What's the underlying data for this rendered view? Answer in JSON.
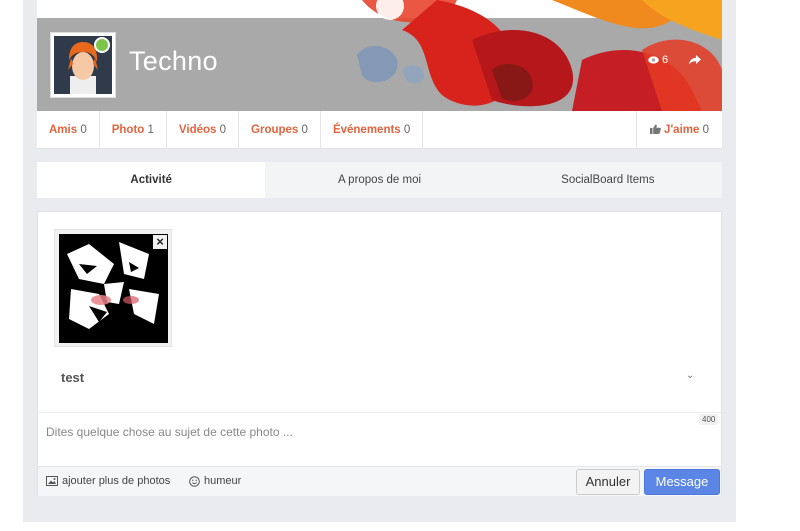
{
  "profile": {
    "name": "Techno",
    "views_count": "6",
    "avatar_icon": "user-avatar-orange-hair"
  },
  "stats": [
    {
      "label": "Amis",
      "count": "0"
    },
    {
      "label": "Photo",
      "count": "1"
    },
    {
      "label": "Vidéos",
      "count": "0"
    },
    {
      "label": "Groupes",
      "count": "0"
    },
    {
      "label": "Événements",
      "count": "0"
    }
  ],
  "like": {
    "label": "J'aime",
    "count": "0"
  },
  "tabs": [
    {
      "label": "Activité",
      "active": true
    },
    {
      "label": "A propos de moi",
      "active": false
    },
    {
      "label": "SocialBoard Items",
      "active": false
    }
  ],
  "composer": {
    "album_name": "test",
    "caption_placeholder": "Dites quelque chose au sujet de cette photo ...",
    "char_counter": "400",
    "add_photos_label": "ajouter plus de photos",
    "mood_label": "humeur",
    "cancel_label": "Annuler",
    "submit_label": "Message",
    "remove_icon": "×"
  },
  "colors": {
    "accent_orange": "#e2643f",
    "online": "#7cc44b",
    "submit_blue": "#5b86e5"
  }
}
